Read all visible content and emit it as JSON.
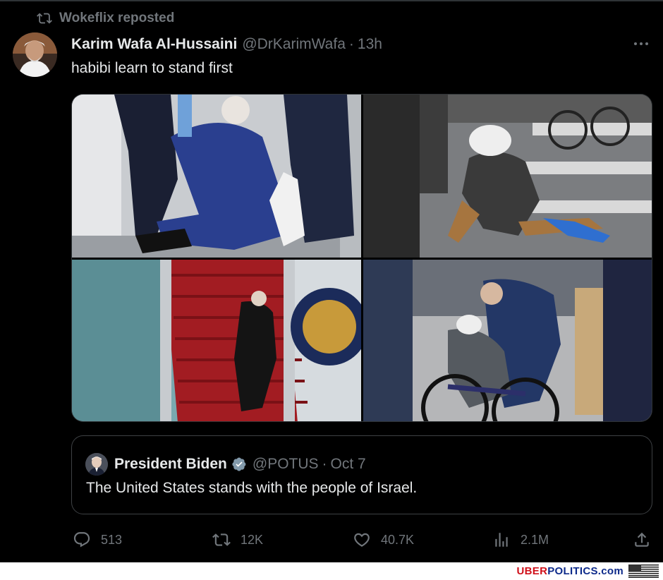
{
  "repost": {
    "icon": "repost-icon",
    "label": "Wokeflix reposted"
  },
  "author": {
    "name": "Karim Wafa Al-Hussaini",
    "handle": "@DrKarimWafa",
    "separator": "·",
    "time": "13h",
    "avatar_icon": "avatar"
  },
  "tweet": {
    "text": "habibi learn to stand first"
  },
  "media": {
    "images": [
      {
        "name": "photo-kneeling-man-helped"
      },
      {
        "name": "photo-bicycle-fall-crosswalk"
      },
      {
        "name": "photo-stairs-aircraft"
      },
      {
        "name": "photo-bicycle-fall-crowd"
      }
    ]
  },
  "quote": {
    "name": "President Biden",
    "verified_icon": "verified-badge-icon",
    "handle": "@POTUS",
    "separator": "·",
    "time": "Oct 7",
    "text": "The United States stands with the people of Israel."
  },
  "actions": {
    "reply": "513",
    "repost": "12K",
    "like": "40.7K",
    "views": "2.1M"
  },
  "watermark": {
    "part1": "UBER",
    "part2": "POLITICS.com"
  },
  "colors": {
    "background": "#000000",
    "text": "#e7e9ea",
    "muted": "#71767b",
    "border": "#2f3336",
    "brand_red": "#d0101a",
    "brand_blue": "#0d2a8a"
  }
}
